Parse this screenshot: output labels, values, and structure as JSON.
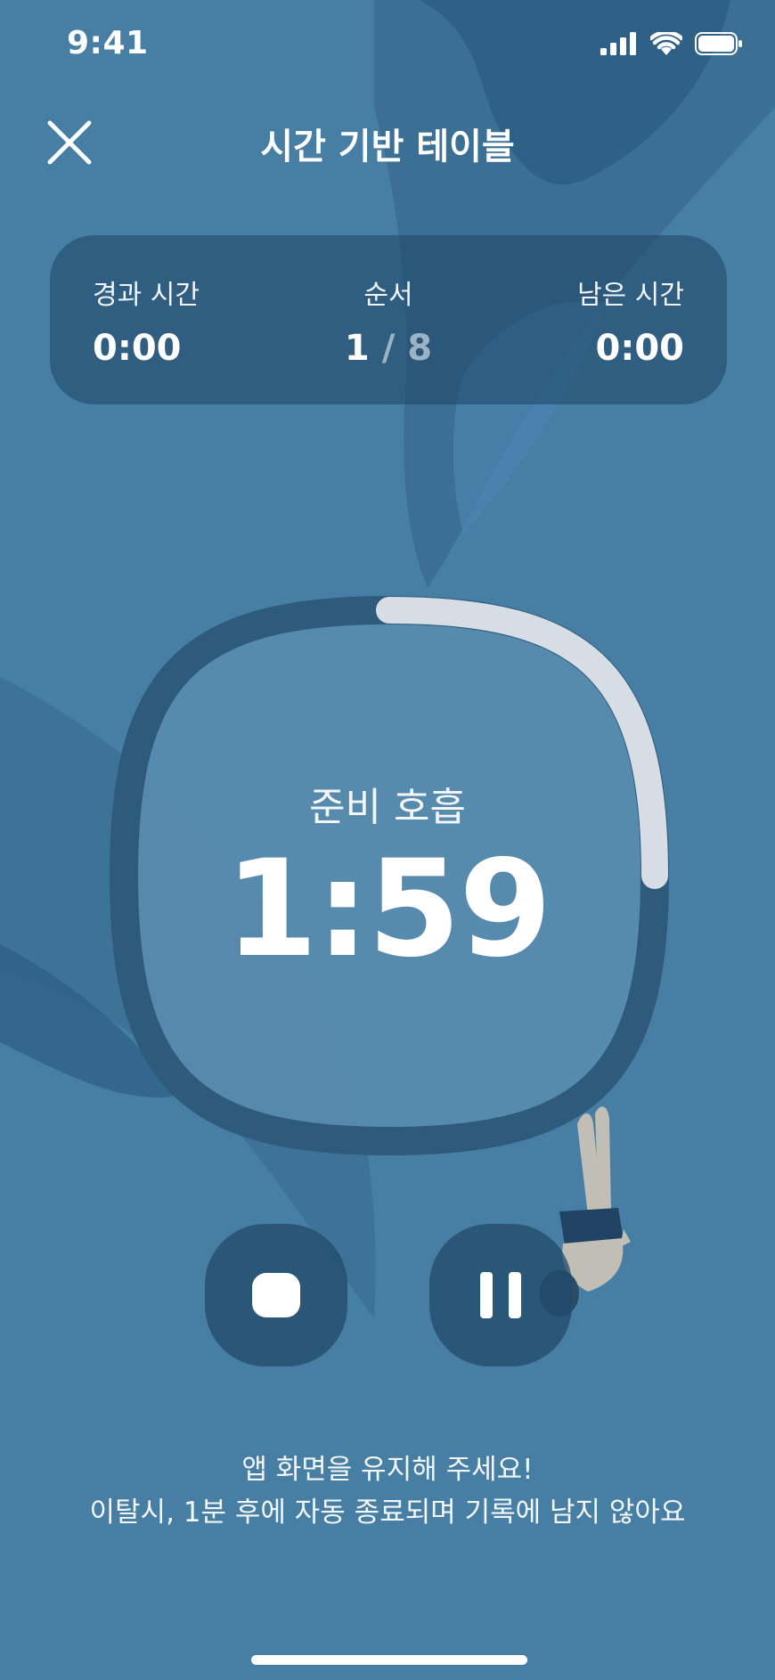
{
  "status_bar": {
    "time": "9:41"
  },
  "header": {
    "title": "시간 기반 테이블",
    "close_icon": "close-icon"
  },
  "stats": {
    "elapsed_label": "경과 시간",
    "elapsed_value": "0:00",
    "order_label": "순서",
    "order_current": "1",
    "order_separator": "/",
    "order_total": "8",
    "remaining_label": "남은 시간",
    "remaining_value": "0:00"
  },
  "timer": {
    "phase_label": "준비 호흡",
    "value": "1:59",
    "progress": 0.25
  },
  "controls": {
    "stop_icon": "stop-icon",
    "pause_icon": "pause-icon"
  },
  "notice": {
    "line1": "앱 화면을 유지해 주세요!",
    "line2": "이탈시, 1분 후에 자동 종료되며 기록에 남지 않아요"
  },
  "colors": {
    "background": "#467ea4",
    "card": "#224a6a",
    "ring_track": "#2e5a7c",
    "ring_progress": "#d6dde4",
    "ring_inner": "#5b8daf"
  }
}
